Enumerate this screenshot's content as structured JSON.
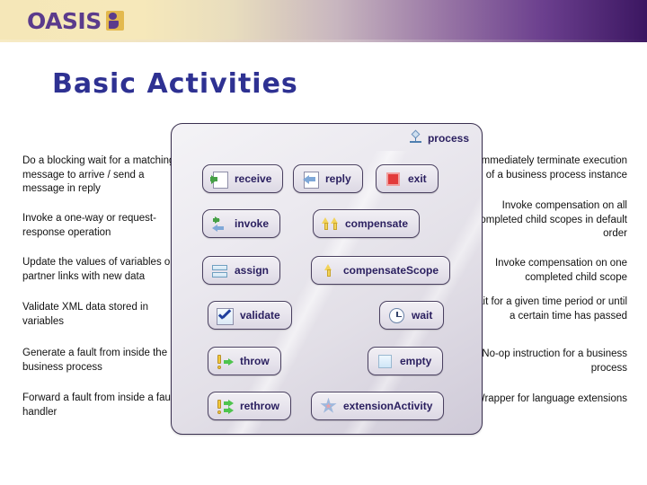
{
  "brand": {
    "name": "OASIS",
    "logo_mark": "oasis-glyph",
    "logo_purple": "#5b3b8c",
    "logo_gold": "#e3b94e"
  },
  "slide": {
    "title": "Basic Activities",
    "title_color": "#2e3192"
  },
  "panel": {
    "label": "process",
    "label_icon": "process-icon"
  },
  "left_notes": [
    "Do a blocking wait for a matching message to arrive / send a message in reply",
    "Invoke a one-way or request-response operation",
    "Update the values of variables or partner links with new data",
    "Validate XML data stored in variables",
    "Generate a fault from inside the business process",
    "Forward a fault from inside a fault handler"
  ],
  "right_notes": [
    "Immediately terminate execution of a business process instance",
    "Invoke compensation on all completed child scopes in default order",
    "Invoke compensation on one completed child scope",
    "Wait for a given time period or until a certain time has passed",
    "No-op instruction for a business process",
    "Wrapper for language extensions"
  ],
  "activities": {
    "receive": {
      "label": "receive",
      "icon": "receive-icon"
    },
    "reply": {
      "label": "reply",
      "icon": "reply-icon"
    },
    "exit": {
      "label": "exit",
      "icon": "exit-icon"
    },
    "invoke": {
      "label": "invoke",
      "icon": "invoke-icon"
    },
    "compensate": {
      "label": "compensate",
      "icon": "compensate-icon"
    },
    "assign": {
      "label": "assign",
      "icon": "assign-icon"
    },
    "compensateScope": {
      "label": "compensateScope",
      "icon": "compensate-scope-icon"
    },
    "validate": {
      "label": "validate",
      "icon": "validate-icon"
    },
    "wait": {
      "label": "wait",
      "icon": "clock-icon"
    },
    "throw": {
      "label": "throw",
      "icon": "throw-icon"
    },
    "empty": {
      "label": "empty",
      "icon": "empty-icon"
    },
    "rethrow": {
      "label": "rethrow",
      "icon": "rethrow-icon"
    },
    "extensionActivity": {
      "label": "extensionActivity",
      "icon": "star-icon"
    }
  },
  "colors": {
    "activity_text": "#2b2060",
    "green_arrow": "#46a046",
    "blue_arrow": "#7fa8d8",
    "red_stop": "#e23a3a",
    "yellow_arrow": "#f2d35a"
  }
}
